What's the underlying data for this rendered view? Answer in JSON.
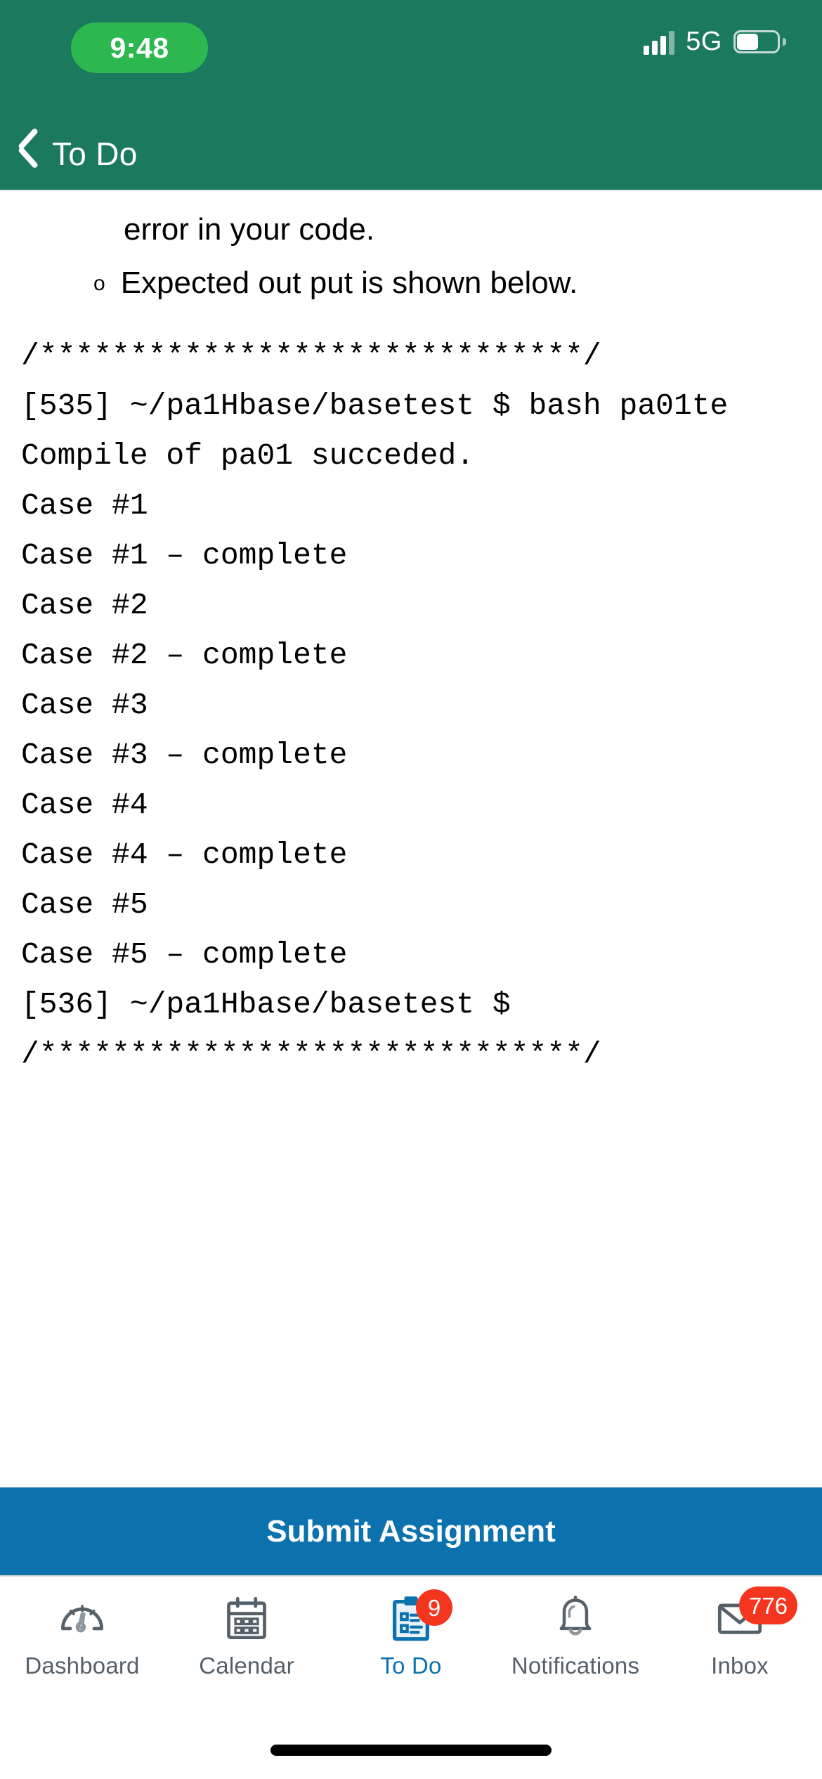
{
  "status_bar": {
    "time": "9:48",
    "network": "5G",
    "signal_icon": "cellular-bars-icon",
    "battery_icon": "battery-icon",
    "time_pill_color": "#2cb84f"
  },
  "nav_bar": {
    "back_label": "To Do",
    "back_icon": "chevron-left-icon",
    "background": "#1b7a5e"
  },
  "content": {
    "continuation_line": "error in your code.",
    "bullet_mark": "o",
    "bullet_text": "Expected out put is shown below.",
    "terminal_lines": [
      "/******************************/",
      "[535] ~/pa1Hbase/basetest $ bash pa01te",
      "Compile of pa01 succeded.",
      "Case #1",
      "Case #1 – complete",
      "Case #2",
      "Case #2 – complete",
      "Case #3",
      "Case #3 – complete",
      "Case #4",
      "Case #4 – complete",
      "Case #5",
      "Case #5 – complete",
      "[536] ~/pa1Hbase/basetest $",
      "/******************************/"
    ]
  },
  "submit": {
    "label": "Submit Assignment",
    "color": "#0b72ae"
  },
  "tab_bar": {
    "active_color": "#0b72ae",
    "inactive_color": "#556069",
    "badge_color": "#f5361f",
    "items": [
      {
        "label": "Dashboard",
        "icon": "gauge-icon",
        "badge": null,
        "active": false
      },
      {
        "label": "Calendar",
        "icon": "calendar-icon",
        "badge": null,
        "active": false
      },
      {
        "label": "To Do",
        "icon": "clipboard-checklist-icon",
        "badge": "9",
        "active": true
      },
      {
        "label": "Notifications",
        "icon": "bell-icon",
        "badge": null,
        "active": false
      },
      {
        "label": "Inbox",
        "icon": "envelope-icon",
        "badge": "776",
        "active": false
      }
    ]
  }
}
